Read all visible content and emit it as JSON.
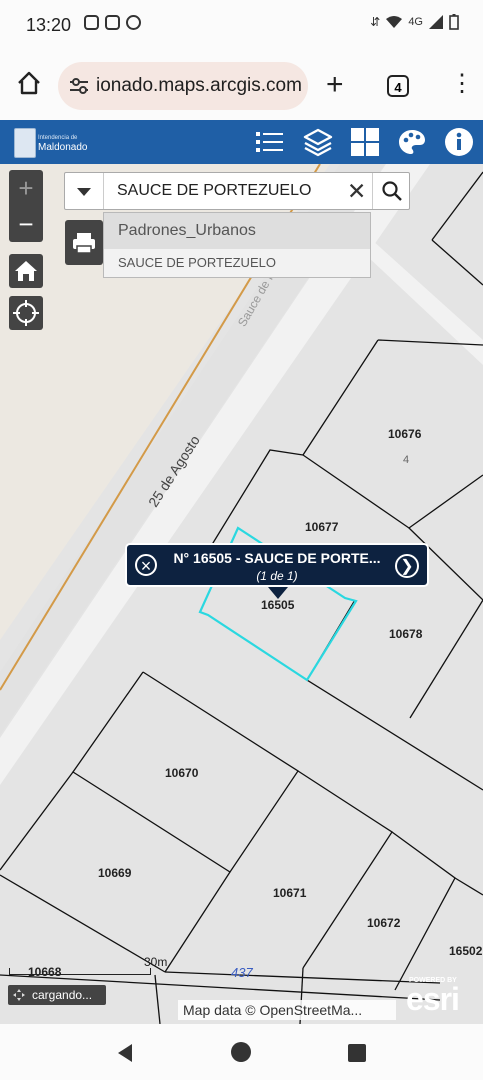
{
  "status_bar": {
    "time": "13:20",
    "network": "4G",
    "app_icons": [
      "instagram-icon",
      "facebook-icon",
      "chrome-icon"
    ],
    "status_icons": [
      "data-arrows-icon",
      "wifi-icon",
      "signal-icon",
      "battery-icon"
    ]
  },
  "browser": {
    "url": "ionado.maps.arcgis.com",
    "tab_count": "4"
  },
  "header": {
    "logo_line1": "Intendencia de",
    "logo_line2": "Maldonado",
    "tools": [
      "legend-list-icon",
      "layers-icon",
      "basemap-gallery-icon",
      "palette-icon",
      "info-icon"
    ],
    "accent_color": "#1f5fa6"
  },
  "search": {
    "value": "SAUCE DE PORTEZUELO",
    "suggestions": {
      "group": "Padrones_Urbanos",
      "item": "SAUCE DE PORTEZUELO"
    }
  },
  "map": {
    "street_labels": {
      "main": "25 de Agosto",
      "side": "Sauce de P",
      "route": "437"
    },
    "lot_number": "4",
    "parcels": [
      "10676",
      "10677",
      "16505",
      "10678",
      "10670",
      "10669",
      "10671",
      "10672",
      "16502",
      "10668"
    ],
    "selection_color": "#2ad8e0"
  },
  "popup": {
    "title": "N° 16505 - SAUCE DE PORTE...",
    "subtitle": "(1 de 1)"
  },
  "scale": {
    "label": "30m"
  },
  "status": {
    "loading": "cargando..."
  },
  "attribution": "Map data © OpenStreetMa...",
  "esri": {
    "powered_by": "POWERED BY",
    "logo": "esri"
  }
}
